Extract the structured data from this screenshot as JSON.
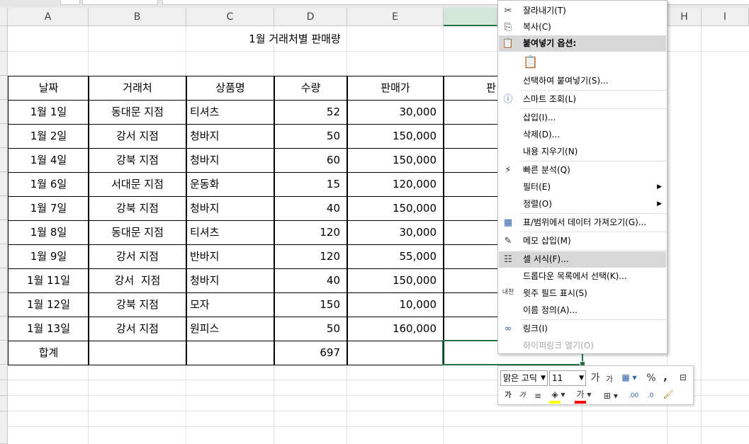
{
  "columns": [
    "A",
    "B",
    "C",
    "D",
    "E",
    "F",
    "G",
    "H",
    "I"
  ],
  "rows": [
    "",
    "",
    "",
    "",
    "",
    "",
    "",
    "",
    "",
    "",
    "",
    "",
    "",
    "",
    "",
    "",
    "",
    ""
  ],
  "title": "1월 거래처별 판매량",
  "table": {
    "headers": [
      "날짜",
      "거래처",
      "상품명",
      "수량",
      "판매가",
      "판"
    ],
    "rows": [
      {
        "date": "1월 1일",
        "client": "동대문 지점",
        "product": "티셔츠",
        "qty": "52",
        "price": "30,000"
      },
      {
        "date": "1월 2일",
        "client": "강서 지점",
        "product": "청바지",
        "qty": "50",
        "price": "150,000"
      },
      {
        "date": "1월 4일",
        "client": "강북 지점",
        "product": "청바지",
        "qty": "60",
        "price": "150,000"
      },
      {
        "date": "1월 6일",
        "client": "서대문 지점",
        "product": "운동화",
        "qty": "15",
        "price": "120,000"
      },
      {
        "date": "1월 7일",
        "client": "강북 지점",
        "product": "청바지",
        "qty": "40",
        "price": "150,000"
      },
      {
        "date": "1월 8일",
        "client": "동대문 지점",
        "product": "티셔츠",
        "qty": "120",
        "price": "30,000"
      },
      {
        "date": "1월 9일",
        "client": "강서 지점",
        "product": "반바지",
        "qty": "120",
        "price": "55,000"
      },
      {
        "date": "1월 11일",
        "client": "강서  지점",
        "product": "청바지",
        "qty": "40",
        "price": "150,000"
      },
      {
        "date": "1월 12일",
        "client": "강북 지점",
        "product": "모자",
        "qty": "150",
        "price": "10,000"
      },
      {
        "date": "1월 13일",
        "client": "강서 지점",
        "product": "원피스",
        "qty": "50",
        "price": "160,000"
      }
    ],
    "total_label": "합계",
    "total_qty": "697"
  },
  "context_menu": {
    "items": [
      {
        "icon": "✂",
        "label": "잘라내기(T)"
      },
      {
        "icon": "⎘",
        "label": "복사(C)"
      },
      {
        "icon": "📋",
        "label": "붙여넣기 옵션:"
      },
      {
        "icon": "",
        "label": "선택하여 붙여넣기(S)..."
      },
      {
        "icon": "ⓘ",
        "label": "스마트 조회(L)"
      },
      {
        "icon": "",
        "label": "삽입(I)..."
      },
      {
        "icon": "",
        "label": "삭제(D)..."
      },
      {
        "icon": "",
        "label": "내용 지우기(N)"
      },
      {
        "icon": "⚡",
        "label": "빠른 분석(Q)"
      },
      {
        "icon": "",
        "label": "필터(E)"
      },
      {
        "icon": "",
        "label": "정렬(O)"
      },
      {
        "icon": "▦",
        "label": "표/범위에서 데이터 가져오기(G)..."
      },
      {
        "icon": "✎",
        "label": "메모 삽입(M)"
      },
      {
        "icon": "☷",
        "label": "셀 서식(F)..."
      },
      {
        "icon": "",
        "label": "드롭다운 목록에서 선택(K)..."
      },
      {
        "icon": "내천",
        "label": "윗주 필드 표시(S)"
      },
      {
        "icon": "",
        "label": "이름 정의(A)..."
      },
      {
        "icon": "∞",
        "label": "링크(I)"
      },
      {
        "icon": "",
        "label": "하이퍼링크 열기(O)"
      }
    ]
  },
  "mini_toolbar": {
    "font_name": "맑은 고딕",
    "font_size": "11",
    "grow_font": "가",
    "shrink_font": "가",
    "percent": "%",
    "comma": ",",
    "bold": "가",
    "italic": "가",
    "font_color": "가",
    "dec_inc": ".00",
    "dec_dec": ".0"
  },
  "colors": {
    "accent": "#217346",
    "highlight": "#d7d7d7",
    "fill_yellow": "#ffff00",
    "font_red": "#ff0000"
  }
}
